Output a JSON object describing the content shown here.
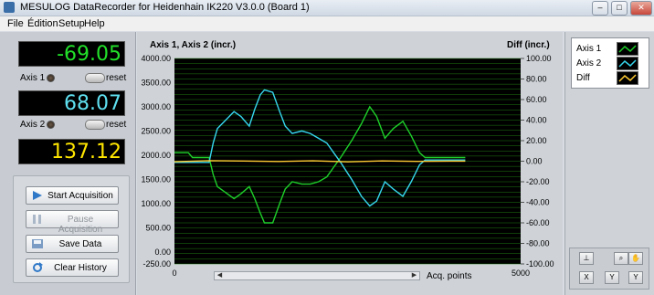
{
  "window": {
    "title": "MESULOG DataRecorder for Heidenhain IK220 V3.0.0 (Board 1)",
    "minimize": "–",
    "maximize": "□",
    "close": "✕"
  },
  "menu": [
    "File",
    "Édition",
    "Setup",
    "Help"
  ],
  "readouts": {
    "axis1": {
      "value": "-69.05",
      "label": "Axis 1",
      "reset": "reset",
      "color": "#22e02a"
    },
    "axis2": {
      "value": "68.07",
      "label": "Axis 2",
      "reset": "reset",
      "color": "#5fe0f0"
    },
    "diff": {
      "value": "137.12",
      "color": "#ffe600"
    }
  },
  "buttons": {
    "start": "Start Acquisition",
    "pause": "Pause Acquisition",
    "save": "Save Data",
    "clear": "Clear History"
  },
  "legend": [
    {
      "name": "Axis 1",
      "color": "#1ecf2a",
      "icon": "line-icon"
    },
    {
      "name": "Axis 2",
      "color": "#36d6ee",
      "icon": "line-icon"
    },
    {
      "name": "Diff",
      "color": "#ffcc33",
      "icon": "line-icon"
    }
  ],
  "tools": [
    "cursor-tool-icon",
    "zoom-tool-icon",
    "pan-tool-icon",
    "x-scale-icon",
    "y-scale-icon",
    "y-scale-2-icon"
  ],
  "chart_data": {
    "type": "line",
    "title_left": "Axis 1, Axis 2 (incr.)",
    "title_right": "Diff (incr.)",
    "xlabel": "Acq. points",
    "x_ticks": [
      "0",
      "5000"
    ],
    "xlim": [
      0,
      5000
    ],
    "ylim": [
      -250,
      4000
    ],
    "y_ticks": [
      "4000.00",
      "3500.00",
      "3000.00",
      "2500.00",
      "2000.00",
      "1500.00",
      "1000.00",
      "500.00",
      "0.00",
      "-250.00"
    ],
    "y2lim": [
      -100,
      100
    ],
    "y2_ticks": [
      "100.00",
      "80.00",
      "60.00",
      "40.00",
      "20.00",
      "0.00",
      "-20.00",
      "-40.00",
      "-60.00",
      "-80.00",
      "-100.00"
    ],
    "grid": true,
    "series": [
      {
        "name": "Axis 1",
        "axis": "left",
        "color": "#1ecf2a",
        "x": [
          0,
          200,
          260,
          500,
          560,
          620,
          860,
          960,
          1080,
          1160,
          1240,
          1300,
          1420,
          1520,
          1600,
          1700,
          1840,
          1960,
          2080,
          2200,
          2300,
          2400,
          2560,
          2700,
          2820,
          2920,
          3040,
          3160,
          3300,
          3420,
          3540,
          3620,
          4000,
          4200
        ],
        "y": [
          2050,
          2050,
          1950,
          1950,
          1600,
          1350,
          1100,
          1200,
          1350,
          1100,
          800,
          600,
          600,
          1000,
          1300,
          1450,
          1400,
          1400,
          1450,
          1550,
          1750,
          1950,
          2300,
          2650,
          3000,
          2800,
          2350,
          2550,
          2700,
          2400,
          2050,
          1950,
          1950,
          1950
        ]
      },
      {
        "name": "Axis 2",
        "axis": "left",
        "color": "#36d6ee",
        "x": [
          0,
          200,
          260,
          500,
          560,
          620,
          860,
          960,
          1080,
          1160,
          1240,
          1300,
          1420,
          1520,
          1600,
          1700,
          1840,
          1960,
          2080,
          2200,
          2300,
          2400,
          2560,
          2700,
          2820,
          2920,
          3040,
          3160,
          3300,
          3420,
          3540,
          3620,
          4000,
          4200
        ],
        "y": [
          1850,
          1850,
          1850,
          1850,
          2250,
          2550,
          2900,
          2800,
          2600,
          2950,
          3250,
          3350,
          3300,
          2900,
          2600,
          2450,
          2500,
          2450,
          2350,
          2250,
          2050,
          1850,
          1500,
          1150,
          950,
          1050,
          1450,
          1300,
          1150,
          1450,
          1800,
          1900,
          1900,
          1900
        ]
      },
      {
        "name": "Diff",
        "axis": "right",
        "color": "#ffcc33",
        "x": [
          0,
          500,
          1000,
          1500,
          2000,
          2500,
          3000,
          3500,
          4000,
          4200
        ],
        "y": [
          -0.5,
          0.5,
          0.2,
          -0.3,
          0.4,
          -0.6,
          0.3,
          -0.2,
          0.1,
          0.1
        ]
      }
    ]
  }
}
